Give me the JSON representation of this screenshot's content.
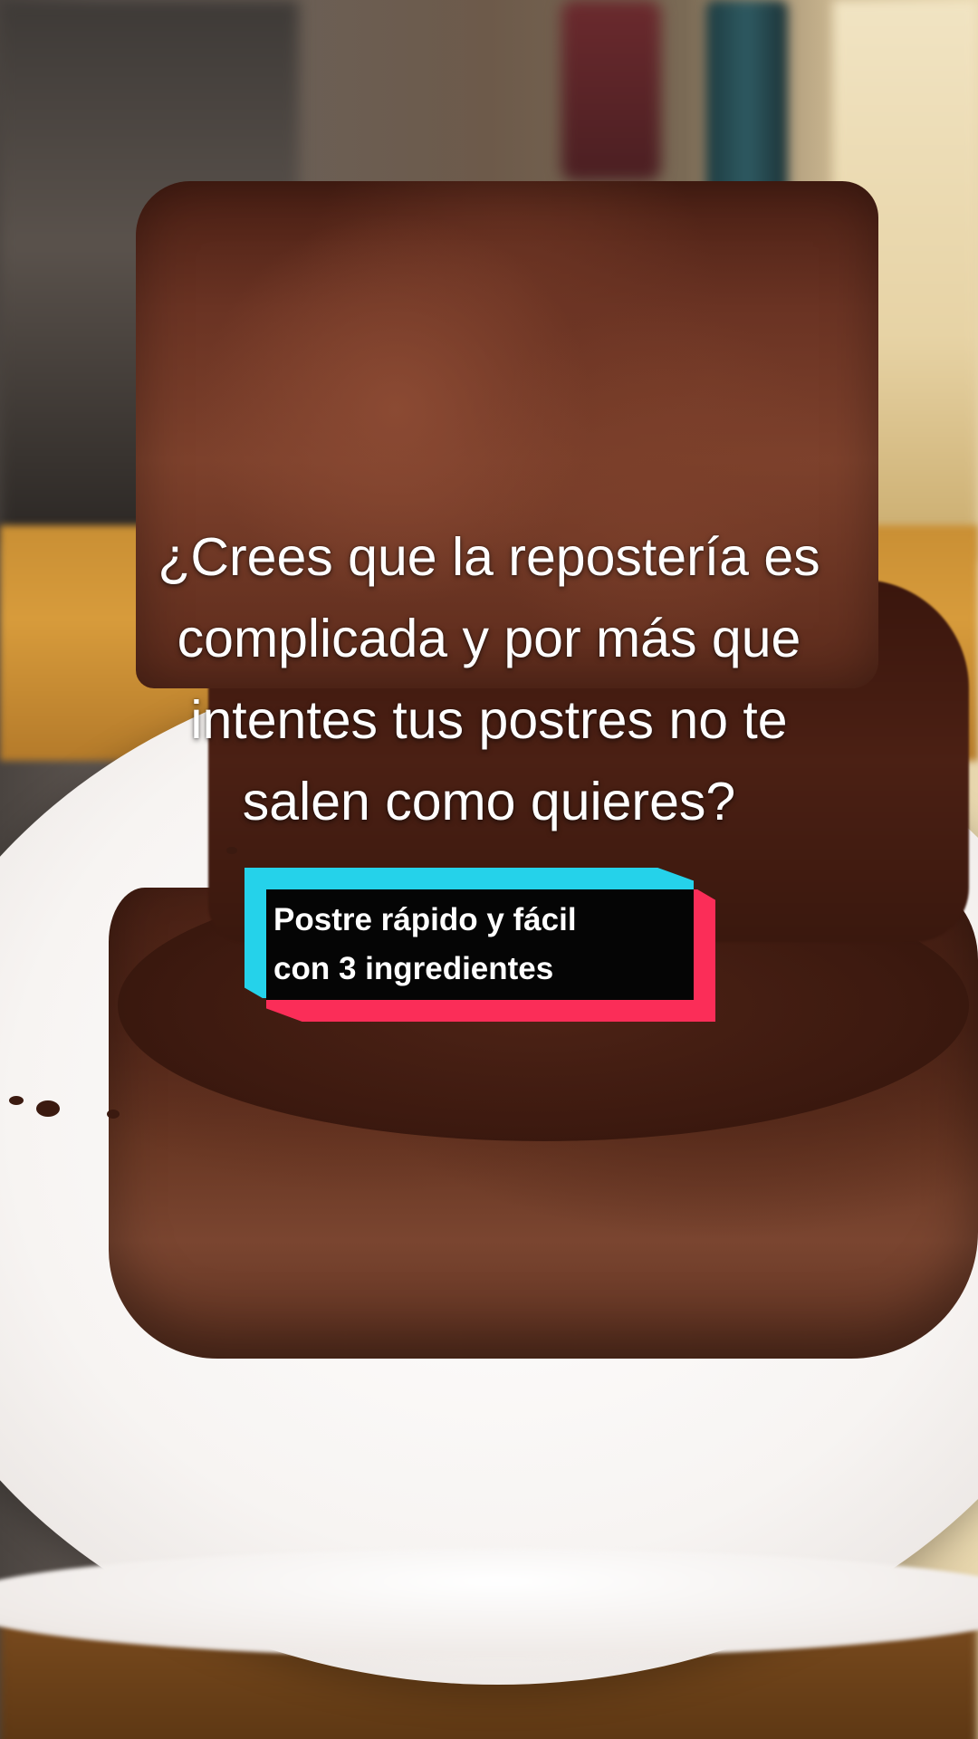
{
  "overlay": {
    "headline_lines": [
      "¿Crees que la repostería es",
      "complicada y por más que",
      "intentes tus postres no te",
      "salen como quieres?"
    ]
  },
  "caption": {
    "lines": [
      "Postre rápido y fácil",
      "con 3 ingredientes"
    ],
    "colors": {
      "background": "#050505",
      "accent_cyan": "#25d2ea",
      "accent_pink": "#fb2d58",
      "text": "#ffffff"
    }
  }
}
